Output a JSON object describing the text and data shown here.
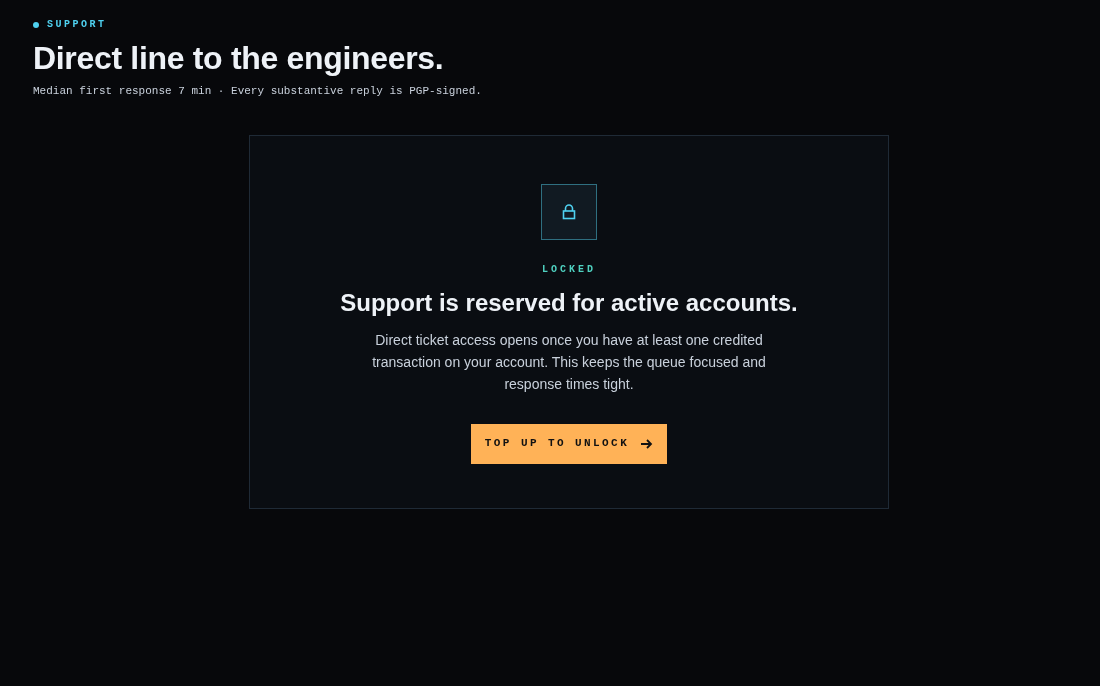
{
  "eyebrow": "SUPPORT",
  "title": "Direct line to the engineers.",
  "subtitle": "Median first response 7 min · Every substantive reply is PGP-signed.",
  "card": {
    "status": "LOCKED",
    "heading": "Support is reserved for active accounts.",
    "body": "Direct ticket access opens once you have at least one credited transaction on your account. This keeps the queue focused and response times tight.",
    "button": "TOP UP TO UNLOCK"
  }
}
